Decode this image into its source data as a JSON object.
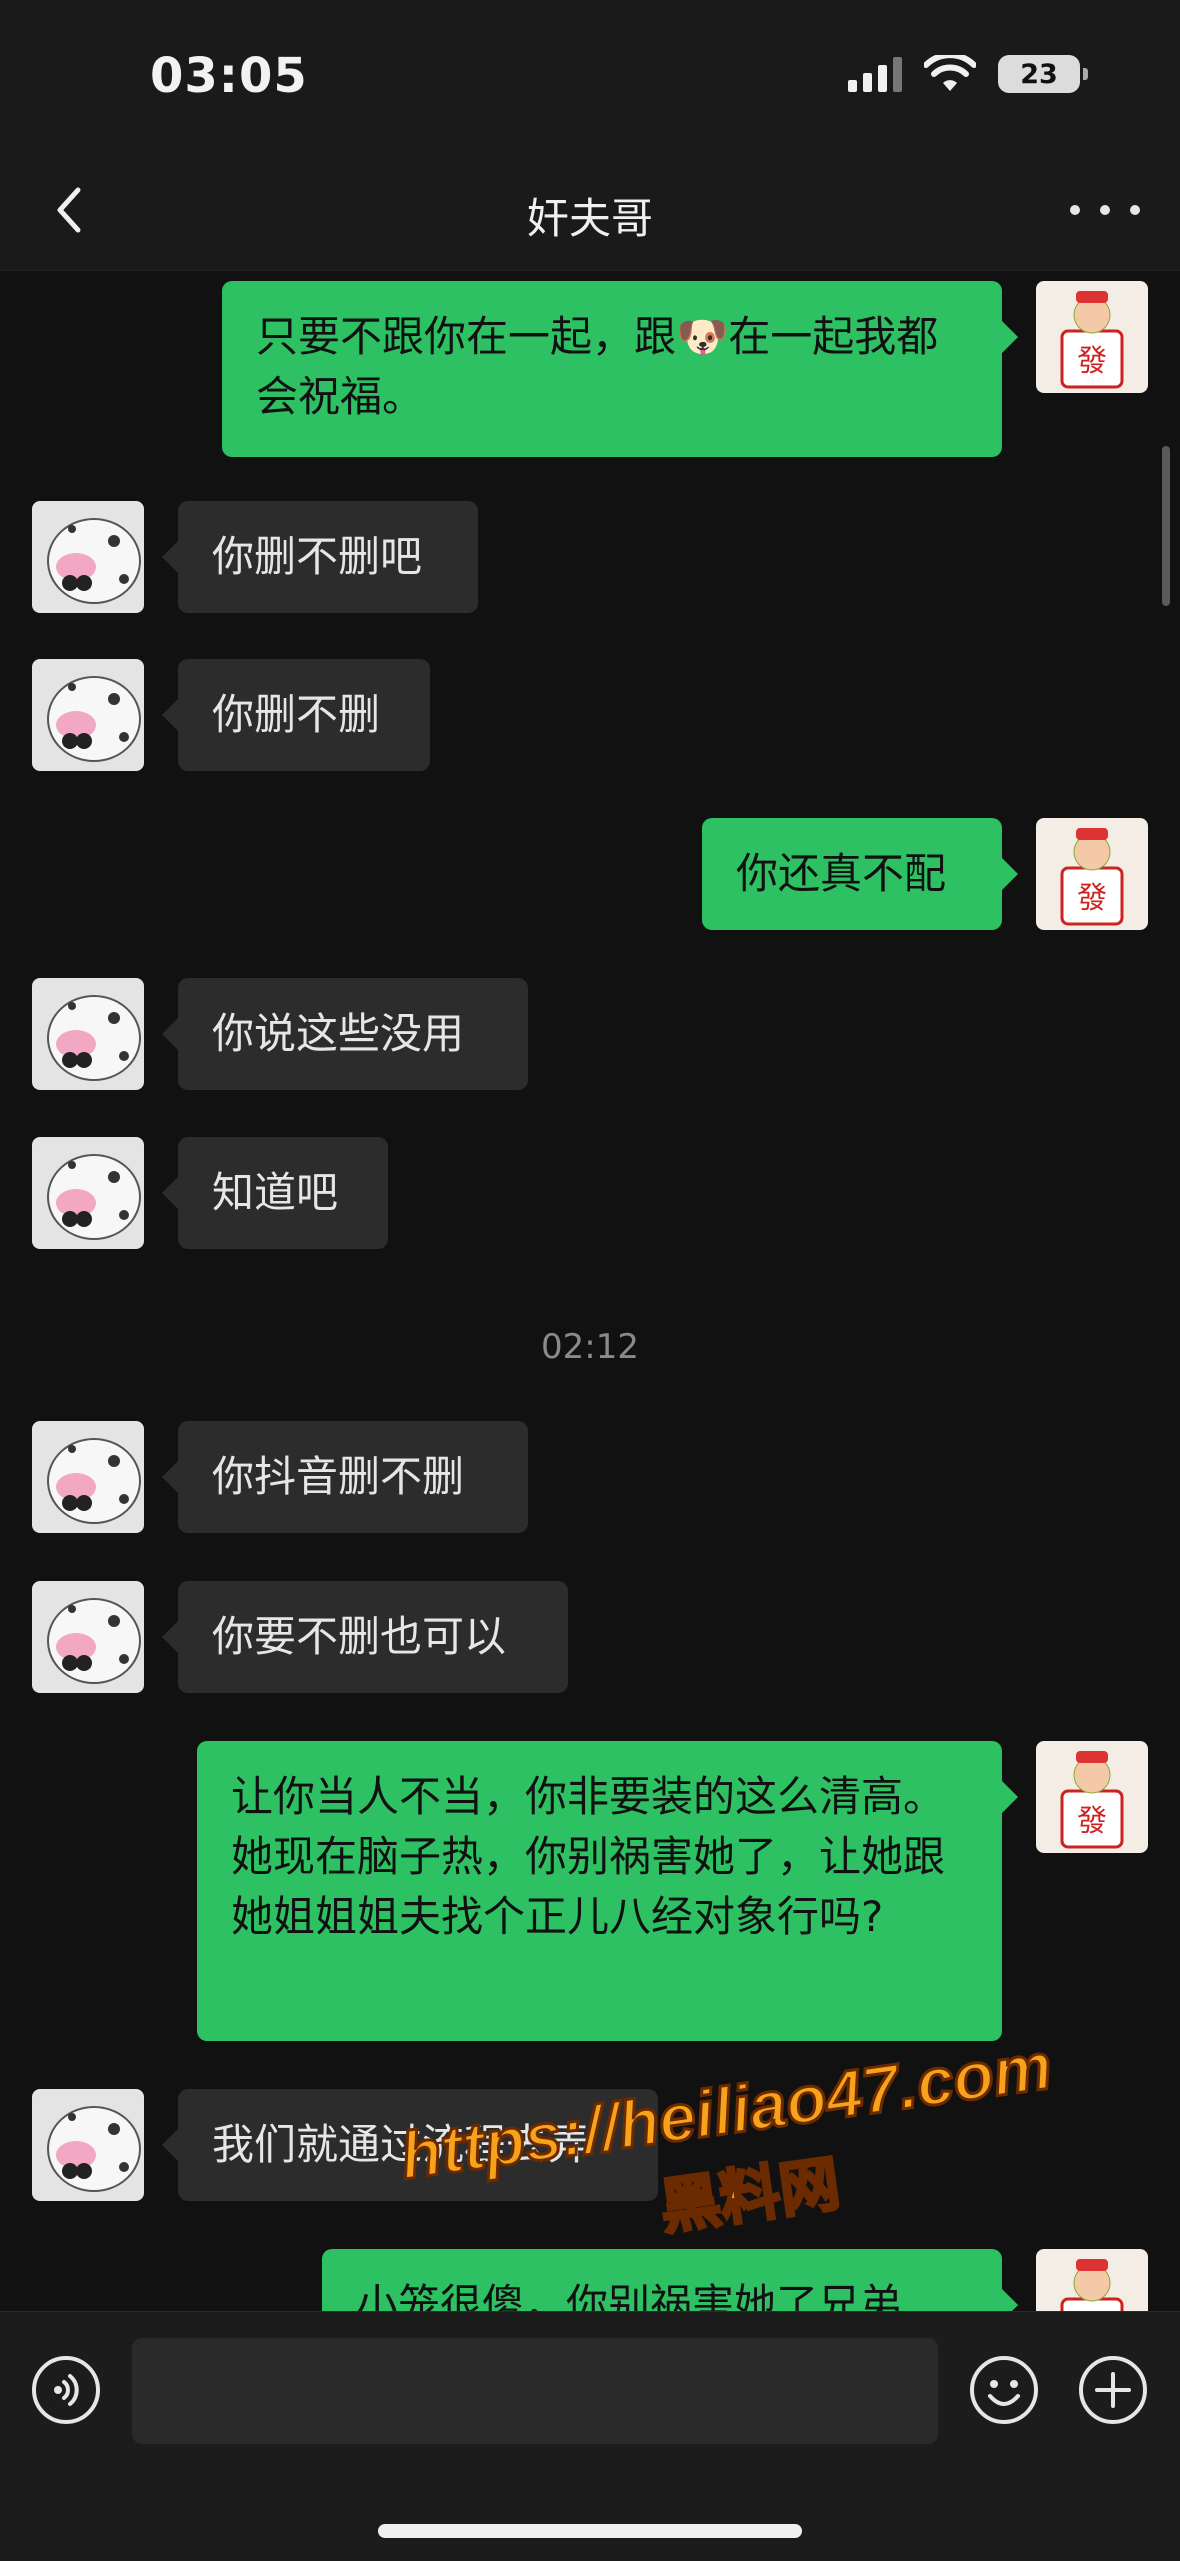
{
  "status": {
    "time": "03:05",
    "battery": "23"
  },
  "nav": {
    "title": "奸夫哥"
  },
  "messages": [
    {
      "side": "out",
      "text": "只要不跟你在一起，跟🐶在一起我都会祝福。"
    },
    {
      "side": "in",
      "text": "你删不删吧"
    },
    {
      "side": "in",
      "text": "你删不删"
    },
    {
      "side": "out",
      "text": "你还真不配"
    },
    {
      "side": "in",
      "text": "你说这些没用"
    },
    {
      "side": "in",
      "text": "知道吧"
    },
    {
      "time": "02:12"
    },
    {
      "side": "in",
      "text": "你抖音删不删"
    },
    {
      "side": "in",
      "text": "你要不删也可以"
    },
    {
      "side": "out",
      "text": "让你当人不当，你非要装的这么清高。她现在脑子热，你别祸害她了，让她跟她姐姐姐夫找个正儿八经对象行吗?"
    },
    {
      "side": "in",
      "text": "我们就通过流程去弄"
    },
    {
      "side": "out",
      "text": "小笼很傻，你别祸害她了兄弟"
    }
  ],
  "watermark": {
    "url": "https://heiliao47.com",
    "name": "黑料网"
  }
}
